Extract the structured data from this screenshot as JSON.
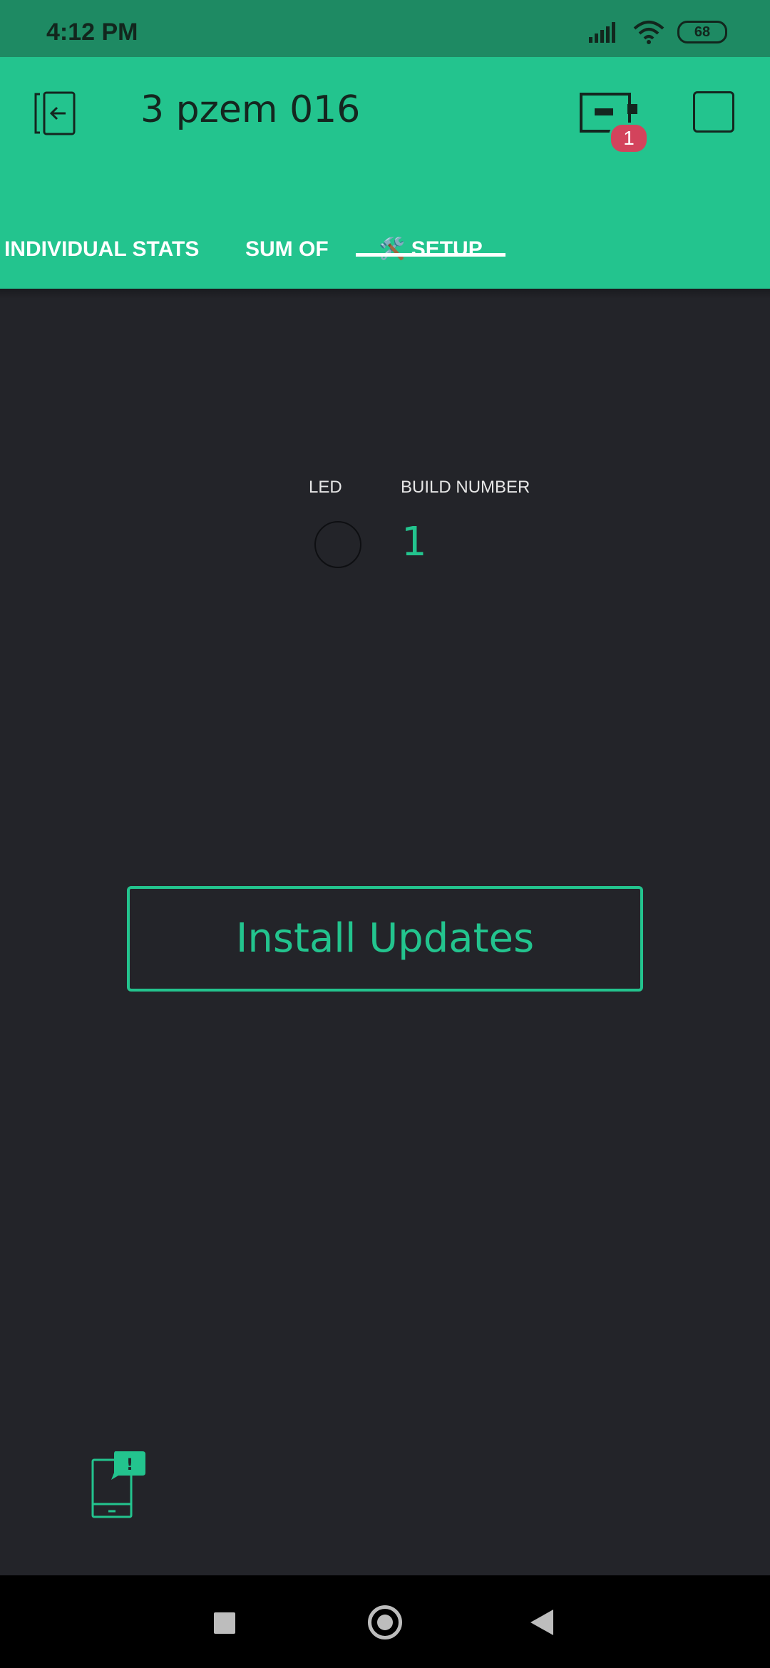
{
  "status_bar": {
    "time": "4:12 PM",
    "battery": "68",
    "icons": [
      "signal-icon",
      "wifi-icon",
      "battery-icon"
    ]
  },
  "app_bar": {
    "title": "3 pzem 016",
    "device_badge": "1",
    "icons": [
      "exit-icon",
      "device-board-icon",
      "stop-icon"
    ]
  },
  "tabs": [
    {
      "label": "INDIVIDUAL STATS",
      "selected": false
    },
    {
      "label": "SUM OF",
      "selected": false
    },
    {
      "label": "🛠️ SETUP",
      "selected": true
    }
  ],
  "widgets": {
    "led_label": "LED",
    "build_label": "BUILD NUMBER",
    "build_value": "1"
  },
  "install_button": {
    "label": "Install Updates"
  },
  "colors": {
    "accent": "#23c48e",
    "background": "#232429",
    "status_bar": "#1e8a63",
    "badge": "#d3435c"
  },
  "nav": {
    "icons": [
      "recents-icon",
      "home-icon",
      "back-icon"
    ]
  }
}
